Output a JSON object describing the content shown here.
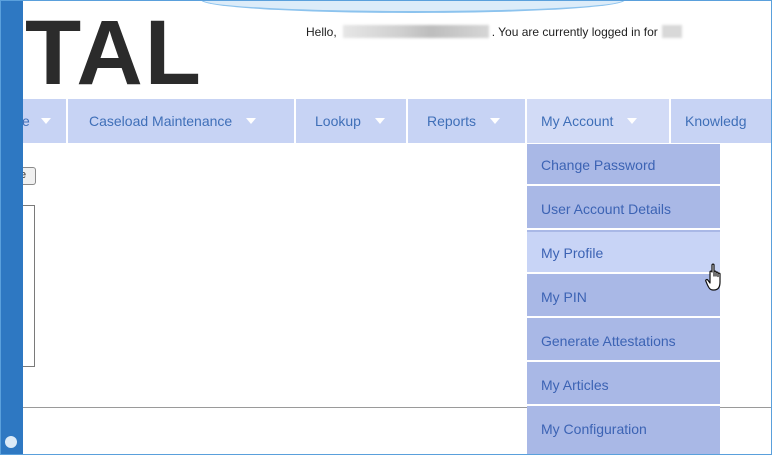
{
  "header": {
    "logo_text": "TAL",
    "greeting_prefix": "Hello,",
    "greeting_suffix": ". You are currently logged in for"
  },
  "nav": {
    "items": [
      {
        "label": "e"
      },
      {
        "label": "Caseload Maintenance"
      },
      {
        "label": "Lookup"
      },
      {
        "label": "Reports"
      },
      {
        "label": "My Account"
      },
      {
        "label": "Knowledg"
      }
    ]
  },
  "content": {
    "small_button_label": "e"
  },
  "dropdown": {
    "items": [
      {
        "label": "Change Password"
      },
      {
        "label": "User Account Details"
      },
      {
        "label": "My Profile",
        "hovered": true
      },
      {
        "label": "My PIN"
      },
      {
        "label": "Generate Attestations"
      },
      {
        "label": "My Articles"
      },
      {
        "label": "My Configuration"
      }
    ]
  },
  "icons": {
    "cursor": "hand-pointer-icon",
    "caret": "caret-down-icon"
  },
  "colors": {
    "nav_bg": "#c7d3f4",
    "dropdown_bg": "#a9b8e6",
    "dropdown_hover": "#c8d4f6",
    "link": "#3c63b4"
  }
}
